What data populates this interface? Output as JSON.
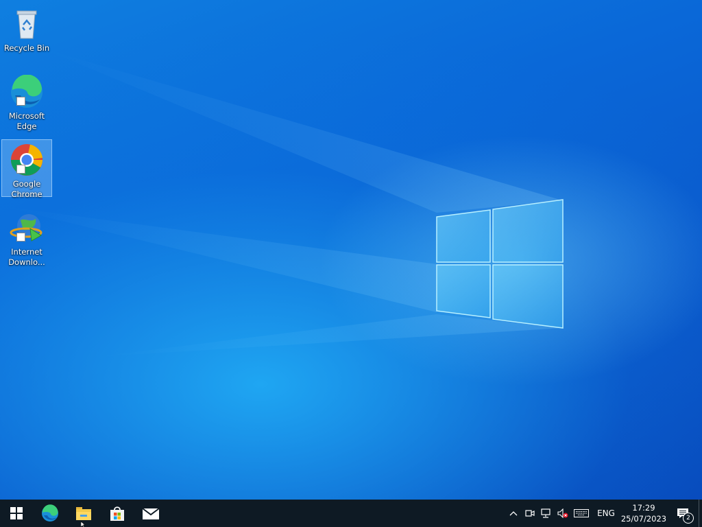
{
  "desktop": {
    "icons": [
      {
        "label": "Recycle Bin",
        "icon": "recycle-bin-icon"
      },
      {
        "label": "Microsoft\nEdge",
        "icon": "edge-icon"
      },
      {
        "label": "Google\nChrome",
        "icon": "chrome-icon",
        "selected": true
      },
      {
        "label": "Internet\nDownlo...",
        "icon": "idm-icon"
      }
    ]
  },
  "taskbar": {
    "pinned": [
      "start-icon",
      "edge-icon",
      "file-explorer-icon",
      "store-icon",
      "mail-icon"
    ],
    "tray": {
      "icons": [
        "chevron-up-icon",
        "meet-now-icon",
        "network-icon",
        "volume-muted-icon",
        "keyboard-icon"
      ],
      "language": "ENG",
      "time": "17:29",
      "date": "25/07/2023",
      "notification_count": "2"
    }
  },
  "colors": {
    "taskbar": "#0e1a24",
    "accent": "#0a63d6"
  }
}
